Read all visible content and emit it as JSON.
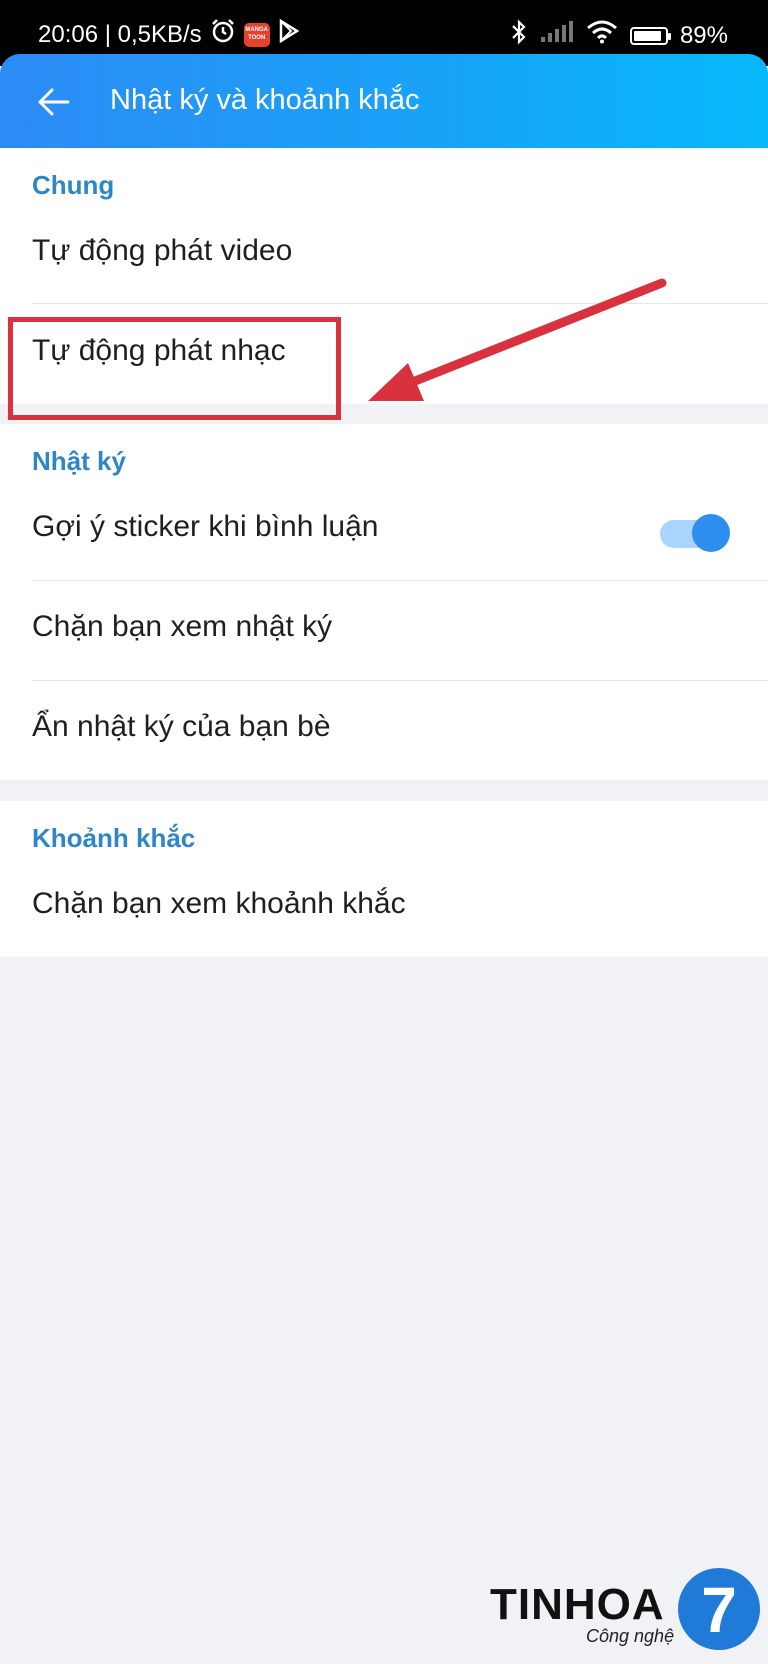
{
  "status_bar": {
    "time_speed": "20:06 | 0,5KB/s",
    "manga_badge": "MANGA TOON",
    "battery_percent": "89%",
    "battery_level": 0.89,
    "icons": [
      "alarm-icon",
      "manga-toon-icon",
      "play-store-icon",
      "bluetooth-icon",
      "signal-icon",
      "wifi-icon",
      "battery-icon"
    ]
  },
  "header": {
    "title": "Nhật ký và khoảnh khắc",
    "back_icon": "arrow-left-icon",
    "gradient": [
      "#2c8bf5",
      "#07b9fb"
    ]
  },
  "sections": {
    "general": {
      "label": "Chung",
      "items": [
        {
          "label": "Tự động phát video"
        },
        {
          "label": "Tự động phát nhạc"
        }
      ]
    },
    "diary": {
      "label": "Nhật ký",
      "items": [
        {
          "label": "Gợi ý sticker khi bình luận",
          "toggle": true
        },
        {
          "label": "Chặn bạn xem nhật ký"
        },
        {
          "label": "Ẩn nhật ký của bạn bè"
        }
      ]
    },
    "moments": {
      "label": "Khoảnh khắc",
      "items": [
        {
          "label": "Chặn bạn xem khoảnh khắc"
        }
      ]
    }
  },
  "colors": {
    "section_label": "#2e86c9",
    "toggle_on": "#2d8ef0",
    "annotation": "#d8323f",
    "background": "#f1f2f5"
  },
  "watermark": {
    "brand": "TINHOA",
    "tagline": "Công nghệ",
    "logo_digit": "7"
  }
}
